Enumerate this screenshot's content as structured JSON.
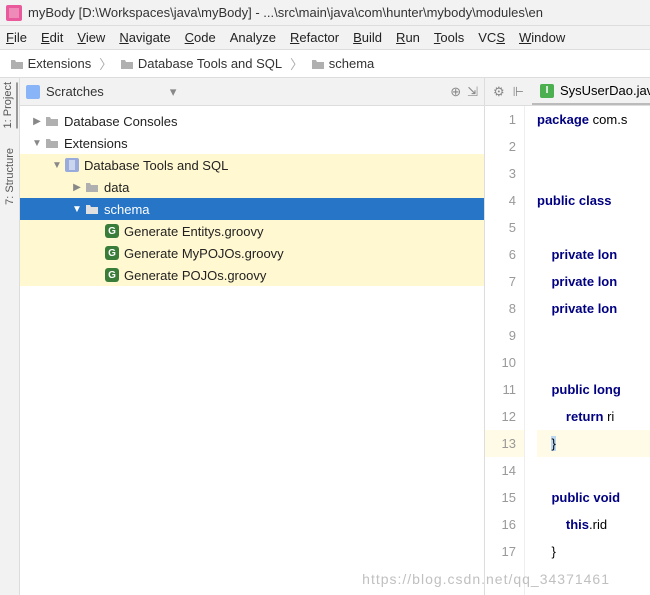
{
  "title_bar": {
    "project": "myBody",
    "path": "[D:\\Workspaces\\java\\myBody] - ...\\src\\main\\java\\com\\hunter\\mybody\\modules\\en"
  },
  "menu": [
    {
      "label": "File",
      "mn": "F"
    },
    {
      "label": "Edit",
      "mn": "E"
    },
    {
      "label": "View",
      "mn": "V"
    },
    {
      "label": "Navigate",
      "mn": "N"
    },
    {
      "label": "Code",
      "mn": "C"
    },
    {
      "label": "Analyze",
      "mn": ""
    },
    {
      "label": "Refactor",
      "mn": "R"
    },
    {
      "label": "Build",
      "mn": "B"
    },
    {
      "label": "Run",
      "mn": "R"
    },
    {
      "label": "Tools",
      "mn": "T"
    },
    {
      "label": "VCS",
      "mn": "S"
    },
    {
      "label": "Window",
      "mn": "W"
    }
  ],
  "breadcrumb": [
    {
      "icon": "folder",
      "label": "Extensions"
    },
    {
      "icon": "folder",
      "label": "Database Tools and SQL"
    },
    {
      "icon": "folder",
      "label": "schema"
    }
  ],
  "side_tabs": [
    {
      "label": "1: Project",
      "sel": true
    },
    {
      "label": "7: Structure",
      "sel": false
    }
  ],
  "panel": {
    "title": "Scratches",
    "tree": [
      {
        "indent": 0,
        "arrow": "▶",
        "icon": "folder",
        "label": "Database Consoles",
        "sel": false,
        "hi": false
      },
      {
        "indent": 0,
        "arrow": "▼",
        "icon": "folder",
        "label": "Extensions",
        "sel": false,
        "hi": false
      },
      {
        "indent": 1,
        "arrow": "▼",
        "icon": "plugin",
        "label": "Database Tools and SQL",
        "sel": false,
        "hi": true
      },
      {
        "indent": 2,
        "arrow": "▶",
        "icon": "folder",
        "label": "data",
        "sel": false,
        "hi": true
      },
      {
        "indent": 2,
        "arrow": "▼",
        "icon": "folder",
        "label": "schema",
        "sel": true,
        "hi": false
      },
      {
        "indent": 3,
        "arrow": "",
        "icon": "groovy",
        "label": "Generate Entitys.groovy",
        "sel": false,
        "hi": true
      },
      {
        "indent": 3,
        "arrow": "",
        "icon": "groovy",
        "label": "Generate MyPOJOs.groovy",
        "sel": false,
        "hi": true
      },
      {
        "indent": 3,
        "arrow": "",
        "icon": "groovy",
        "label": "Generate POJOs.groovy",
        "sel": false,
        "hi": true
      }
    ]
  },
  "editor": {
    "tab_label": "SysUserDao.java",
    "lines": [
      {
        "n": 1,
        "html": "<span class='kw'>package</span> <span class='pkg'>com.s</span>"
      },
      {
        "n": 2,
        "html": ""
      },
      {
        "n": 3,
        "html": ""
      },
      {
        "n": 4,
        "html": "<span class='kw'>public class</span> "
      },
      {
        "n": 5,
        "html": ""
      },
      {
        "n": 6,
        "html": "&nbsp;&nbsp;&nbsp;&nbsp;<span class='kw'>private lon</span>"
      },
      {
        "n": 7,
        "html": "&nbsp;&nbsp;&nbsp;&nbsp;<span class='kw'>private lon</span>"
      },
      {
        "n": 8,
        "html": "&nbsp;&nbsp;&nbsp;&nbsp;<span class='kw'>private lon</span>"
      },
      {
        "n": 9,
        "html": ""
      },
      {
        "n": 10,
        "html": ""
      },
      {
        "n": 11,
        "html": "&nbsp;&nbsp;&nbsp;&nbsp;<span class='kw'>public long</span>"
      },
      {
        "n": 12,
        "html": "&nbsp;&nbsp;&nbsp;&nbsp;&nbsp;&nbsp;&nbsp;&nbsp;<span class='kw'>return</span> ri"
      },
      {
        "n": 13,
        "html": "&nbsp;&nbsp;&nbsp;&nbsp;<span class='caret'>}</span>",
        "hi": true
      },
      {
        "n": 14,
        "html": ""
      },
      {
        "n": 15,
        "html": "&nbsp;&nbsp;&nbsp;&nbsp;<span class='kw'>public void</span>"
      },
      {
        "n": 16,
        "html": "&nbsp;&nbsp;&nbsp;&nbsp;&nbsp;&nbsp;&nbsp;&nbsp;<span class='kw'>this</span>.rid"
      },
      {
        "n": 17,
        "html": "&nbsp;&nbsp;&nbsp;&nbsp;}"
      }
    ]
  },
  "watermark": "https://blog.csdn.net/qq_34371461"
}
